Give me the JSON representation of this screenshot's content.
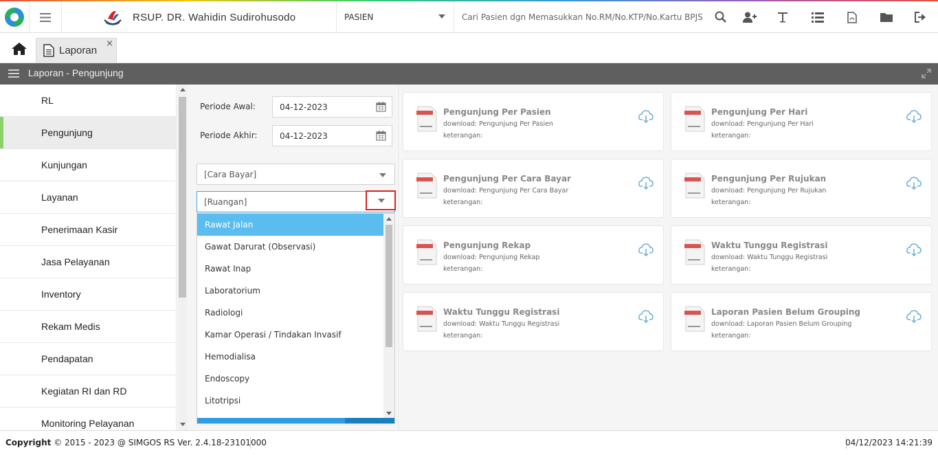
{
  "header": {
    "brand_name": "RSUP. DR. Wahidin Sudirohusodo",
    "mode": "PASIEN",
    "search_placeholder": "Cari Pasien dgn Memasukkan No.RM/No.KTP/No.Kartu BPJS/",
    "icons": [
      "search-icon",
      "add-user-icon",
      "text-icon",
      "list-icon",
      "pdf-icon",
      "folder-icon",
      "logout-icon"
    ]
  },
  "tabs": [
    {
      "label": "Laporan",
      "close": "×"
    }
  ],
  "panel": {
    "title": "Laporan - Pengunjung"
  },
  "sidebar": {
    "items": [
      {
        "label": "RL"
      },
      {
        "label": "Pengunjung",
        "active": true
      },
      {
        "label": "Kunjungan"
      },
      {
        "label": "Layanan"
      },
      {
        "label": "Penerimaan Kasir"
      },
      {
        "label": "Jasa Pelayanan"
      },
      {
        "label": "Inventory"
      },
      {
        "label": "Rekam Medis"
      },
      {
        "label": "Pendapatan"
      },
      {
        "label": "Kegiatan RI dan RD"
      },
      {
        "label": "Monitoring Pelayanan"
      }
    ]
  },
  "filters": {
    "periode_awal_label": "Periode Awal:",
    "periode_awal_value": "04-12-2023",
    "periode_akhir_label": "Periode Akhir:",
    "periode_akhir_value": "04-12-2023",
    "cara_bayar": "[Cara Bayar]",
    "ruangan": "[Ruangan]"
  },
  "dropdown": {
    "options": [
      {
        "label": "Rawat Jalan",
        "selected": true
      },
      {
        "label": "Gawat Darurat (Observasi)"
      },
      {
        "label": "Rawat Inap"
      },
      {
        "label": "Laboratorium"
      },
      {
        "label": "Radiologi"
      },
      {
        "label": "Kamar Operasi / Tindakan Invasif"
      },
      {
        "label": "Hemodialisa"
      },
      {
        "label": "Endoscopy"
      },
      {
        "label": "Litotripsi"
      }
    ]
  },
  "reports": [
    {
      "title": "Pengunjung Per Pasien",
      "download": "download: Pengunjung Per Pasien",
      "keterangan": "keterangan:"
    },
    {
      "title": "Pengunjung Per Hari",
      "download": "download: Pengunjung Per Hari",
      "keterangan": "keterangan:"
    },
    {
      "title": "Pengunjung Per Cara Bayar",
      "download": "download: Pengunjung Per Cara Bayar",
      "keterangan": "keterangan:"
    },
    {
      "title": "Pengunjung Per Rujukan",
      "download": "download: Pengunjung Per Rujukan",
      "keterangan": "keterangan:"
    },
    {
      "title": "Pengunjung Rekap",
      "download": "download: Pengunjung Rekap",
      "keterangan": "keterangan:"
    },
    {
      "title": "Waktu Tunggu Registrasi",
      "download": "download: Waktu Tunggu Registrasi",
      "keterangan": "keterangan:"
    },
    {
      "title": "Waktu Tunggu Registrasi",
      "download": "download: Waktu Tunggu Registrasi",
      "keterangan": "keterangan:"
    },
    {
      "title": "Laporan Pasien Belum Grouping",
      "download": "download: Laporan Pasien Belum Grouping",
      "keterangan": "keterangan:"
    }
  ],
  "footer": {
    "copyright_label": "Copyright",
    "copyright_text": "2015 - 2023 @ SIMGOS RS Ver. 2.4.18-23101000",
    "datetime": "04/12/2023 14:21:39"
  },
  "colors": {
    "panel_header": "#5f5f5f",
    "active_indicator": "#8ed16b",
    "dropdown_selected": "#5bbcf0",
    "highlight_box": "#e0201c"
  }
}
